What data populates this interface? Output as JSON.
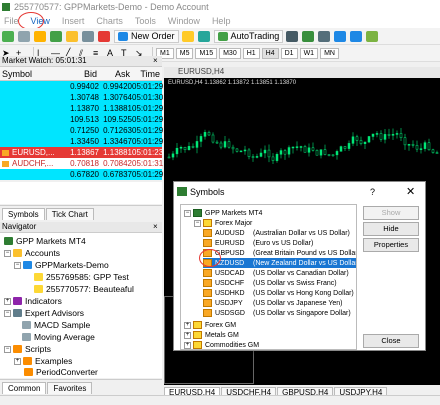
{
  "window": {
    "title": "255770577: GPPMarkets-Demo - Demo Account"
  },
  "menu": [
    "File",
    "View",
    "Insert",
    "Charts",
    "Tools",
    "Window",
    "Help"
  ],
  "toolbar": {
    "new_order": "New Order",
    "autotrading": "AutoTrading",
    "timeframes": [
      "M1",
      "M5",
      "M15",
      "M30",
      "H1",
      "H4",
      "D1",
      "W1",
      "MN"
    ]
  },
  "market_watch": {
    "title": "Market Watch: 05:01:31",
    "columns": [
      "Symbol",
      "Bid",
      "Ask",
      "Time"
    ],
    "rows": [
      {
        "symbol": "",
        "bid": "0.99402",
        "ask": "0.99420",
        "time": "05:01:29",
        "bg": "#00e5ff"
      },
      {
        "symbol": "",
        "bid": "1.30748",
        "ask": "1.30764",
        "time": "05:01:30",
        "bg": "#00e5ff"
      },
      {
        "symbol": "",
        "bid": "1.13870",
        "ask": "1.13881",
        "time": "05:01:29",
        "bg": "#00e5ff"
      },
      {
        "symbol": "",
        "bid": "109.513",
        "ask": "109.525",
        "time": "05:01:29",
        "bg": "#00e5ff"
      },
      {
        "symbol": "",
        "bid": "0.71250",
        "ask": "0.71263",
        "time": "05:01:29",
        "bg": "#00e5ff"
      },
      {
        "symbol": "",
        "bid": "1.33450",
        "ask": "1.33467",
        "time": "05:01:29",
        "bg": "#00e5ff"
      },
      {
        "symbol": "EURUSD,...",
        "bid": "1.13867",
        "ask": "1.13881",
        "time": "05:01:23",
        "bg": "#e53935"
      },
      {
        "symbol": "AUDCHF,...",
        "bid": "0.70818",
        "ask": "0.70842",
        "time": "05:01:31",
        "bg": "#ffffff"
      },
      {
        "symbol": "",
        "bid": "0.67820",
        "ask": "0.67837",
        "time": "05:01:29",
        "bg": "#00e5ff"
      }
    ],
    "tabs": [
      "Symbols",
      "Tick Chart"
    ]
  },
  "navigator": {
    "title": "Navigator",
    "root": "GPP Markets MT4",
    "accounts": "Accounts",
    "server": "GPPMarkets-Demo",
    "acct1": "255769585: GPP Test",
    "acct2": "255770577: Beauteaful",
    "indicators": "Indicators",
    "experts": "Expert Advisors",
    "ea1": "MACD Sample",
    "ea2": "Moving Average",
    "scripts": "Scripts",
    "sc1": "Examples",
    "sc2": "PeriodConverter",
    "tabs": [
      "Common",
      "Favorites"
    ]
  },
  "chart": {
    "window_title": "EURUSD,H4",
    "info": "EURUSD,H4  1.13862 1.13872 1.13851 1.13870",
    "tabs": [
      "EURUSD,H4",
      "USDCHF,H4",
      "GBPUSD,H4",
      "USDJPY,H4"
    ]
  },
  "symbols_dialog": {
    "title": "Symbols",
    "help": "?",
    "close": "✕",
    "root": "GPP Markets MT4",
    "group_major": "Forex Major",
    "symbols": [
      {
        "sym": "AUDUSD",
        "desc": "(Australian Dollar vs US Dollar)"
      },
      {
        "sym": "EURUSD",
        "desc": "(Euro vs US Dollar)"
      },
      {
        "sym": "GBPUSD",
        "desc": "(Great Britain Pound vs US Dollar)"
      },
      {
        "sym": "NZDUSD",
        "desc": "(New Zealand Dollar vs US Dollar)"
      },
      {
        "sym": "USDCAD",
        "desc": "(US Dollar vs Canadian Dollar)"
      },
      {
        "sym": "USDCHF",
        "desc": "(US Dollar vs Swiss Franc)"
      },
      {
        "sym": "USDHKD",
        "desc": "(US Dollar vs Hong Kong Dollar)"
      },
      {
        "sym": "USDJPY",
        "desc": "(US Dollar vs Japanese Yen)"
      },
      {
        "sym": "USDSGD",
        "desc": "(US Dollar vs Singapore Dollar)"
      }
    ],
    "group_gm": "Forex GM",
    "group_metals": "Metals GM",
    "group_comm": "Commodities GM",
    "buttons": {
      "show": "Show",
      "hide": "Hide",
      "properties": "Properties",
      "close": "Close"
    }
  },
  "colors": {
    "accent": "#1976d2",
    "annotation": "#e53935",
    "market_row": "#00e5ff"
  }
}
